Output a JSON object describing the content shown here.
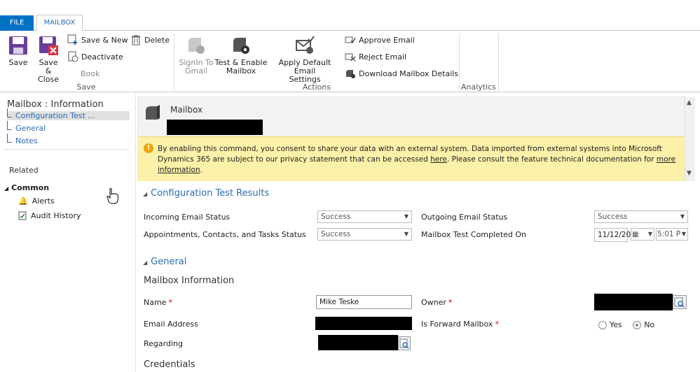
{
  "tabs": {
    "file": "FILE",
    "mailbox": "MAILBOX"
  },
  "ribbon": {
    "save": {
      "save": "Save",
      "save_close_1": "Save &",
      "save_close_2": "Close",
      "save_new": "Save & New",
      "deactivate": "Deactivate",
      "delete": "Delete",
      "book": "Book",
      "group": "Save"
    },
    "actions": {
      "signin_1": "SignIn To",
      "signin_2": "Gmail",
      "test_1": "Test & Enable",
      "test_2": "Mailbox",
      "apply_1": "Apply Default Email",
      "apply_2": "Settings",
      "approve": "Approve Email",
      "reject": "Reject Email",
      "download": "Download Mailbox Details",
      "group": "Actions"
    },
    "analytics": {
      "group": "Analytics"
    }
  },
  "nav": {
    "title": "Mailbox : Information",
    "items": [
      "Configuration Test ...",
      "General",
      "Notes"
    ],
    "related": "Related",
    "common": "Common",
    "related_items": [
      "Alerts",
      "Audit History"
    ]
  },
  "header": {
    "entity": "Mailbox"
  },
  "notice": {
    "text_1": "By enabling this command, you consent to share your data with an external system. Data imported from external systems into Microsoft Dynamics 365 are subject to our privacy statement that can be accessed ",
    "link_1": "here",
    "text_2": ". Please consult the feature technical documentation for ",
    "link_2": "more information",
    "text_3": "."
  },
  "config": {
    "title": "Configuration Test Results",
    "incoming_label": "Incoming Email Status",
    "incoming_value": "Success",
    "appt_label": "Appointments, Contacts, and Tasks Status",
    "appt_value": "Success",
    "outgoing_label": "Outgoing Email Status",
    "outgoing_value": "Success",
    "completed_label": "Mailbox Test Completed On",
    "completed_date": "11/12/20",
    "completed_time": "5:01 P"
  },
  "general": {
    "title": "General",
    "subheading": "Mailbox Information",
    "name_label": "Name",
    "name_value": "Mike Teske",
    "email_label": "Email Address",
    "regarding_label": "Regarding",
    "owner_label": "Owner",
    "forward_label": "Is Forward Mailbox",
    "yes": "Yes",
    "no": "No",
    "forward_selected": "No",
    "credentials": "Credentials"
  },
  "colors": {
    "accent": "#0072c6",
    "link": "#2b6cb0",
    "notice_bg": "#fbf1a9",
    "warning": "#f0a30a",
    "required": "#cc0000"
  }
}
